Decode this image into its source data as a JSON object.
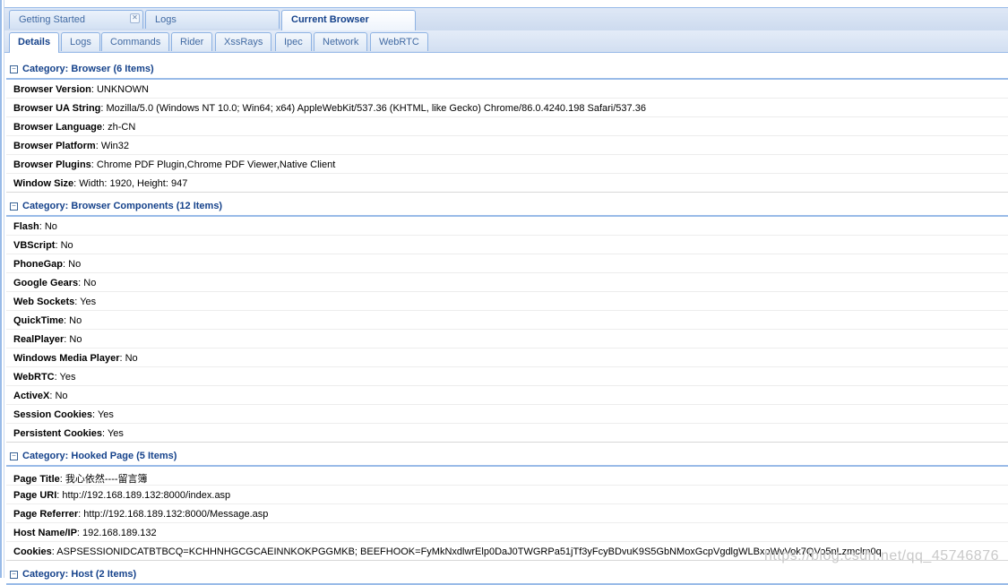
{
  "top_tabs": [
    {
      "label": "Getting Started",
      "closable": true
    },
    {
      "label": "Logs"
    },
    {
      "label": "Current Browser",
      "active": true
    }
  ],
  "sub_tabs": [
    {
      "label": "Details",
      "active": true
    },
    {
      "label": "Logs"
    },
    {
      "label": "Commands"
    },
    {
      "label": "Rider"
    },
    {
      "label": "XssRays"
    },
    {
      "label": "Ipec"
    },
    {
      "label": "Network"
    },
    {
      "label": "WebRTC"
    }
  ],
  "groups": [
    {
      "title": "Category: Browser (6 Items)",
      "rows": [
        {
          "key": "Browser Version",
          "value": ": UNKNOWN"
        },
        {
          "key": "Browser UA String",
          "value": ": Mozilla/5.0 (Windows NT 10.0; Win64; x64) AppleWebKit/537.36 (KHTML, like Gecko) Chrome/86.0.4240.198 Safari/537.36"
        },
        {
          "key": "Browser Language",
          "value": ": zh-CN"
        },
        {
          "key": "Browser Platform",
          "value": ": Win32"
        },
        {
          "key": "Browser Plugins",
          "value": ": Chrome PDF Plugin,Chrome PDF Viewer,Native Client"
        },
        {
          "key": "Window Size",
          "value": ": Width: 1920, Height: 947"
        }
      ]
    },
    {
      "title": "Category: Browser Components (12 Items)",
      "rows": [
        {
          "key": "Flash",
          "value": ": No"
        },
        {
          "key": "VBScript",
          "value": ": No"
        },
        {
          "key": "PhoneGap",
          "value": ": No"
        },
        {
          "key": "Google Gears",
          "value": ": No"
        },
        {
          "key": "Web Sockets",
          "value": ": Yes"
        },
        {
          "key": "QuickTime",
          "value": ": No"
        },
        {
          "key": "RealPlayer",
          "value": ": No"
        },
        {
          "key": "Windows Media Player",
          "value": ": No"
        },
        {
          "key": "WebRTC",
          "value": ": Yes"
        },
        {
          "key": "ActiveX",
          "value": ": No"
        },
        {
          "key": "Session Cookies",
          "value": ": Yes"
        },
        {
          "key": "Persistent Cookies",
          "value": ": Yes"
        }
      ]
    },
    {
      "title": "Category: Hooked Page (5 Items)",
      "rows": [
        {
          "key": "Page Title",
          "value": ": 我心依然----留言簿"
        },
        {
          "key": "Page URI",
          "value": ": http://192.168.189.132:8000/index.asp"
        },
        {
          "key": "Page Referrer",
          "value": ": http://192.168.189.132:8000/Message.asp"
        },
        {
          "key": "Host Name/IP",
          "value": ": 192.168.189.132"
        },
        {
          "key": "Cookies",
          "value": ": ASPSESSIONIDCATBTBCQ=KCHHNHGCGCAEINNKOKPGGMKB; BEEFHOOK=FyMkNxdlwrElp0DaJ0TWGRPa51jTf3yFcyBDvuK9S5GbNMoxGcpVgdlgWLBxoWvVok7QVo5nLzmclm0q"
        }
      ]
    },
    {
      "title": "Category: Host (2 Items)",
      "rows": []
    }
  ],
  "watermark": "https://blog.csdn.net/qq_45746876"
}
